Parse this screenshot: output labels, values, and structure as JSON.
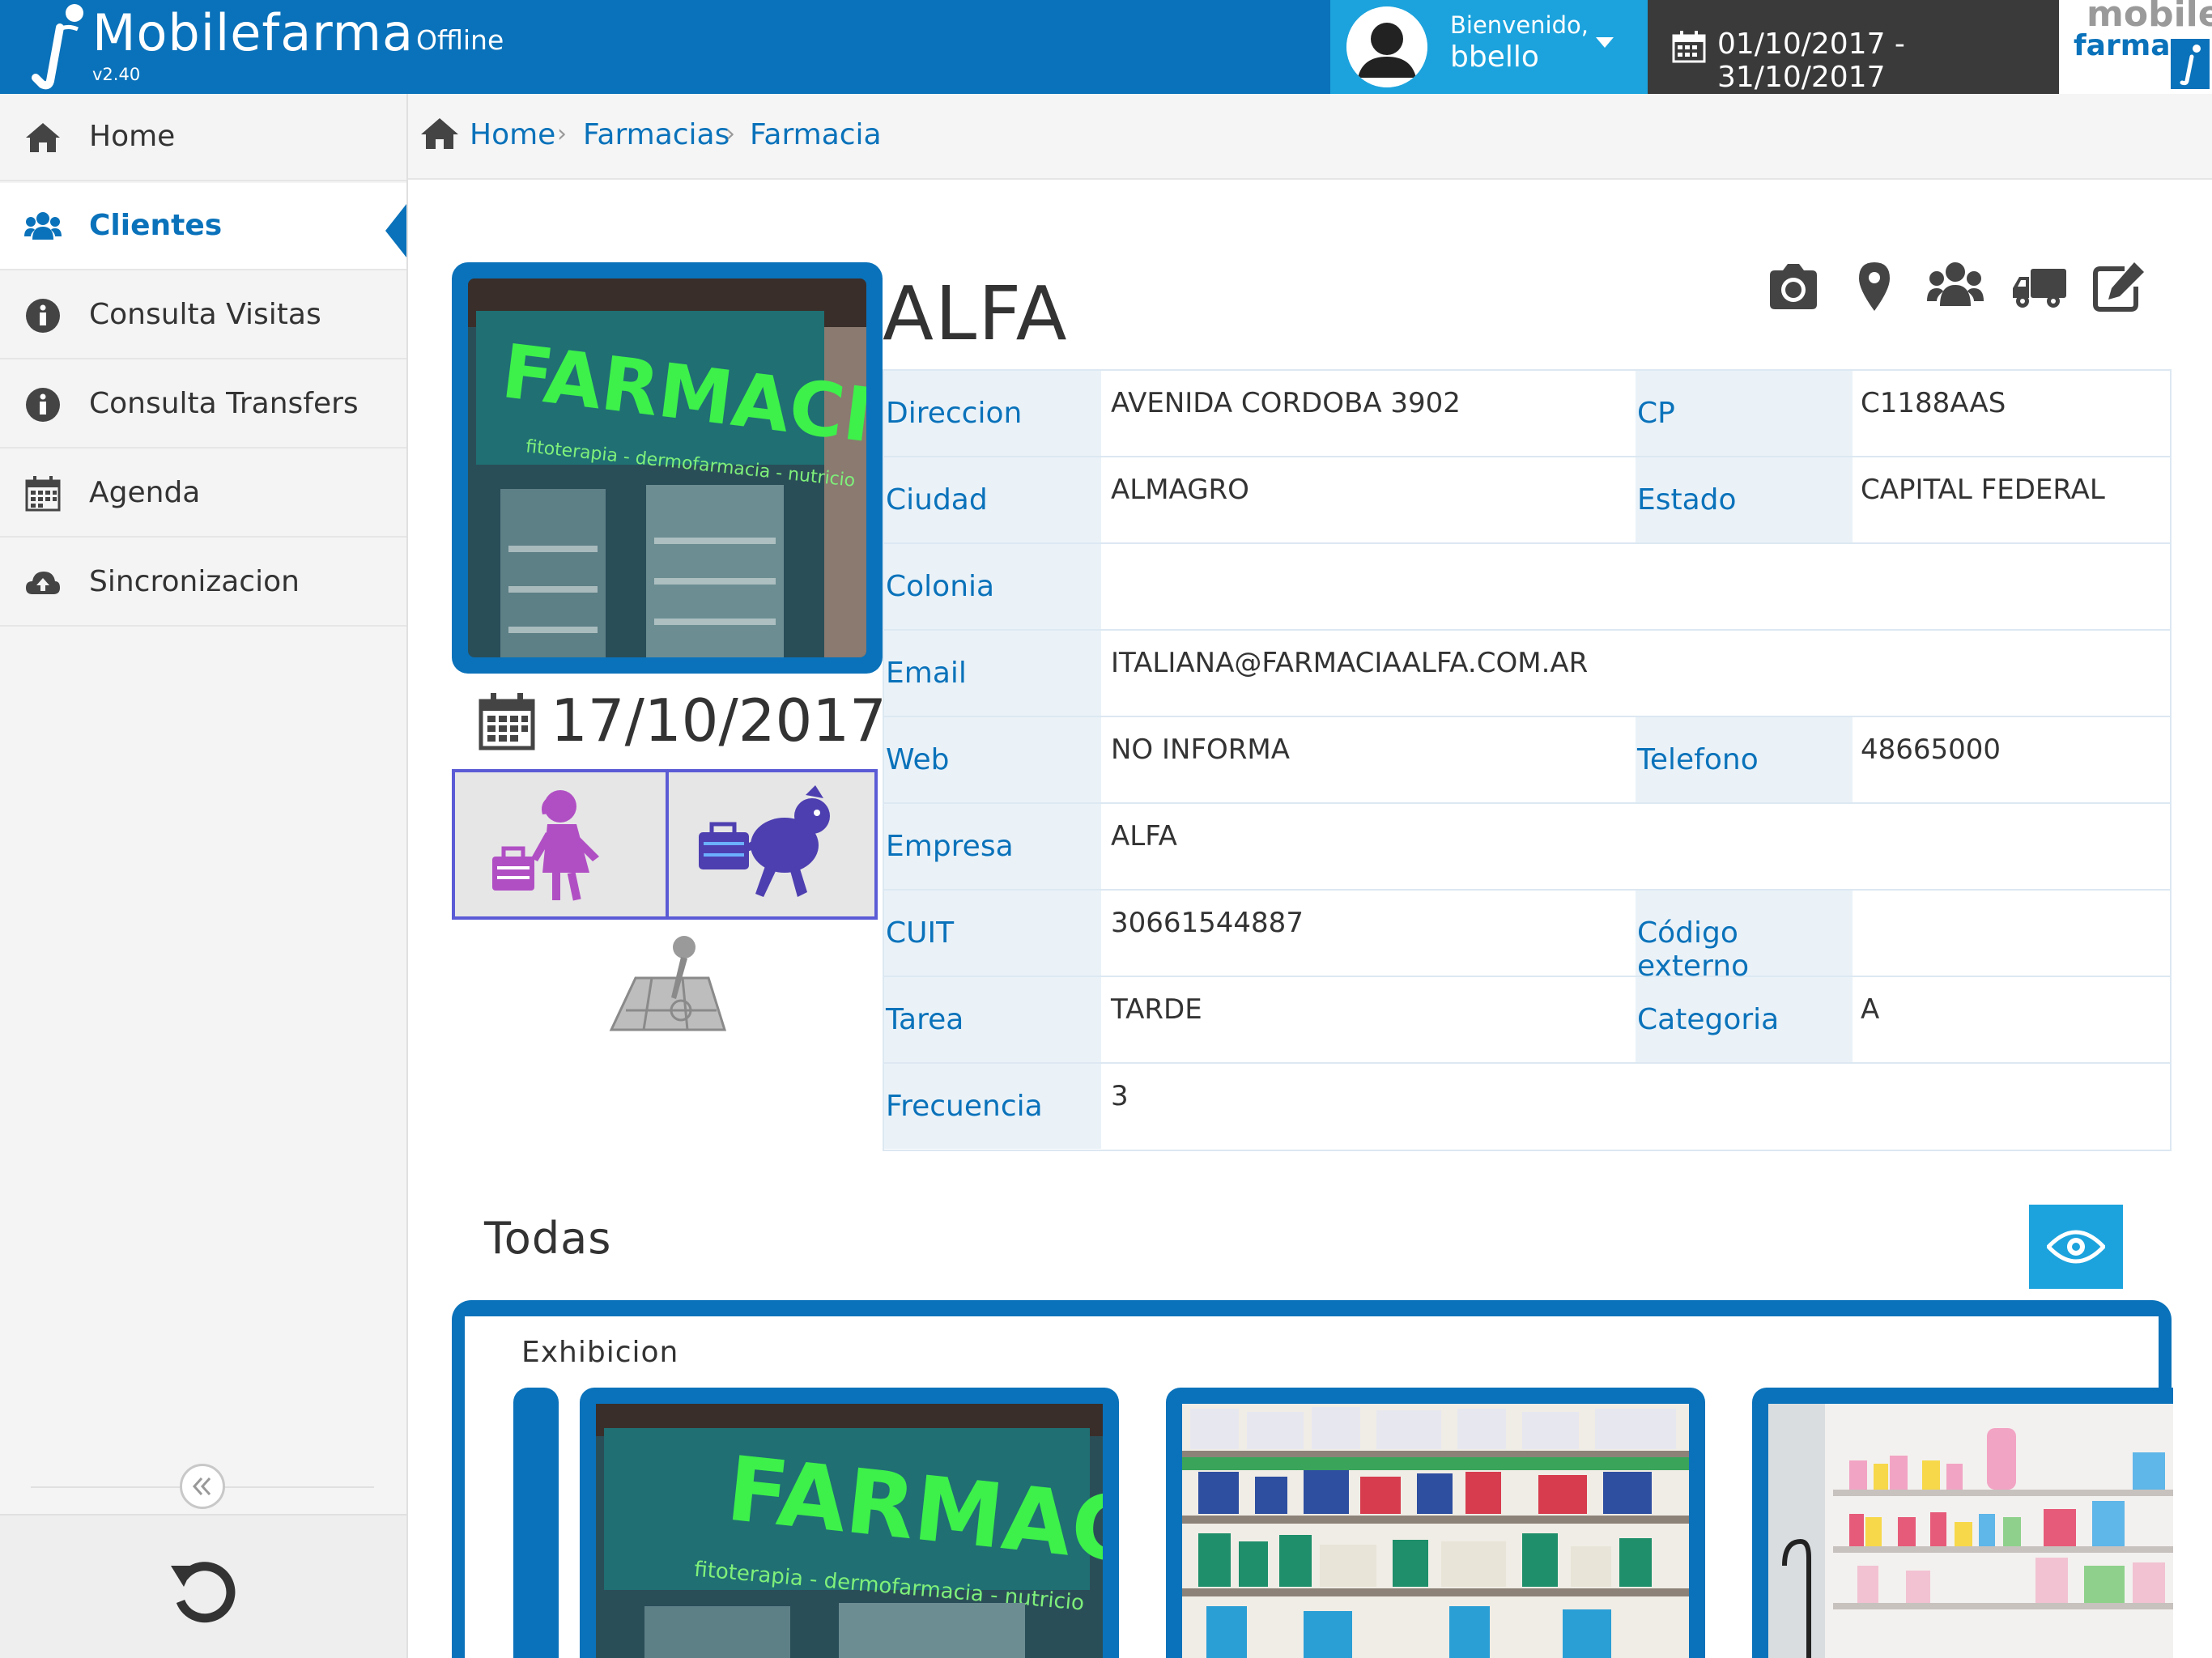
{
  "header": {
    "app_title": "Mobilefarma",
    "status": "Offline",
    "version": "v2.40",
    "welcome": "Bienvenido,",
    "username": "bbello",
    "date_range": "01/10/2017 - 31/10/2017",
    "brand_mobile": "mobile",
    "brand_farma": "farma"
  },
  "sidebar": {
    "items": [
      {
        "label": "Home",
        "icon": "home-icon"
      },
      {
        "label": "Clientes",
        "icon": "users-icon",
        "active": true
      },
      {
        "label": "Consulta Visitas",
        "icon": "info-icon"
      },
      {
        "label": "Consulta Transfers",
        "icon": "info-icon"
      },
      {
        "label": "Agenda",
        "icon": "calendar-icon"
      },
      {
        "label": "Sincronizacion",
        "icon": "cloud-upload-icon"
      }
    ]
  },
  "breadcrumb": [
    "Home",
    "Farmacias",
    "Farmacia"
  ],
  "client": {
    "name": "ALFA",
    "visit_date": "17/10/2017",
    "photo_text_main": "FARMACIA",
    "photo_text_sub": "fitoterapia - dermofarmacia - nutricio",
    "fields": {
      "direccion": {
        "label": "Direccion",
        "value": "AVENIDA CORDOBA 3902"
      },
      "cp": {
        "label": "CP",
        "value": "C1188AAS"
      },
      "ciudad": {
        "label": "Ciudad",
        "value": "ALMAGRO"
      },
      "estado": {
        "label": "Estado",
        "value": "CAPITAL FEDERAL"
      },
      "colonia": {
        "label": "Colonia",
        "value": ""
      },
      "email": {
        "label": "Email",
        "value": "ITALIANA@FARMACIAALFA.COM.AR"
      },
      "web": {
        "label": "Web",
        "value": "NO INFORMA"
      },
      "telefono": {
        "label": "Telefono",
        "value": "48665000"
      },
      "empresa": {
        "label": "Empresa",
        "value": "ALFA"
      },
      "cuit": {
        "label": "CUIT",
        "value": "30661544887"
      },
      "codigo_externo": {
        "label": "Código externo",
        "value": ""
      },
      "tarea": {
        "label": "Tarea",
        "value": "TARDE"
      },
      "categoria": {
        "label": "Categoria",
        "value": "A"
      },
      "frecuencia": {
        "label": "Frecuencia",
        "value": "3"
      }
    }
  },
  "gallery": {
    "title": "Todas",
    "section": "Exhibicion"
  },
  "colors": {
    "primary": "#0a72ba",
    "accent": "#1ca3dd",
    "dark": "#3a3a3a",
    "status_border": "#5b5bd6",
    "female_icon": "#b04fc4",
    "male_icon": "#4d3fb0"
  }
}
